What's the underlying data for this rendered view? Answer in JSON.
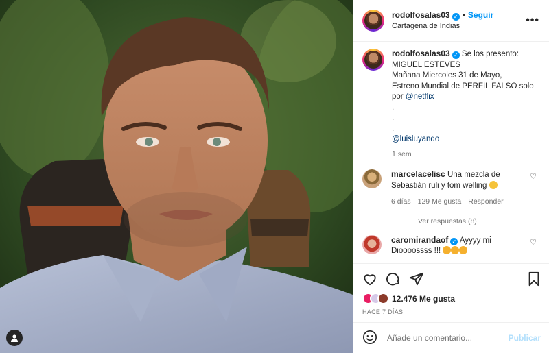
{
  "post": {
    "username": "rodolfosalas03",
    "follow_label": "Seguir",
    "separator": "•",
    "location": "Cartagena de Indias",
    "more_label": "•••"
  },
  "caption": {
    "username": "rodolfosalas03",
    "text": "Se los presento:\nMIGUEL ESTEVES\nMañana Miercoles 31 de Mayo,\nEstreno Mundial de PERFIL FALSO solo por ",
    "mention1": "@netflix",
    "dots": "\n.\n.\n.\n",
    "mention2": "@luisluyando",
    "time": "1 sem"
  },
  "comments": [
    {
      "username": "marcelacelisc",
      "text": "Una mezcla de Sebastián ruli y tom welling",
      "time": "6 días",
      "likes": "129 Me gusta",
      "reply": "Responder",
      "view_replies": "Ver respuestas (8)"
    },
    {
      "username": "caromirandaof",
      "text": "Ayyyy mi Dioooossss !!!"
    }
  ],
  "footer": {
    "likes": "12.476 Me gusta",
    "ago": "HACE 7 DÍAS",
    "comment_placeholder": "Añade un comentario...",
    "publish_label": "Publicar"
  },
  "icons": {
    "heart": "heart-icon",
    "comment": "comment-icon",
    "share": "share-icon",
    "save": "bookmark-icon",
    "emoji": "emoji-icon",
    "user_tag": "user-icon"
  }
}
